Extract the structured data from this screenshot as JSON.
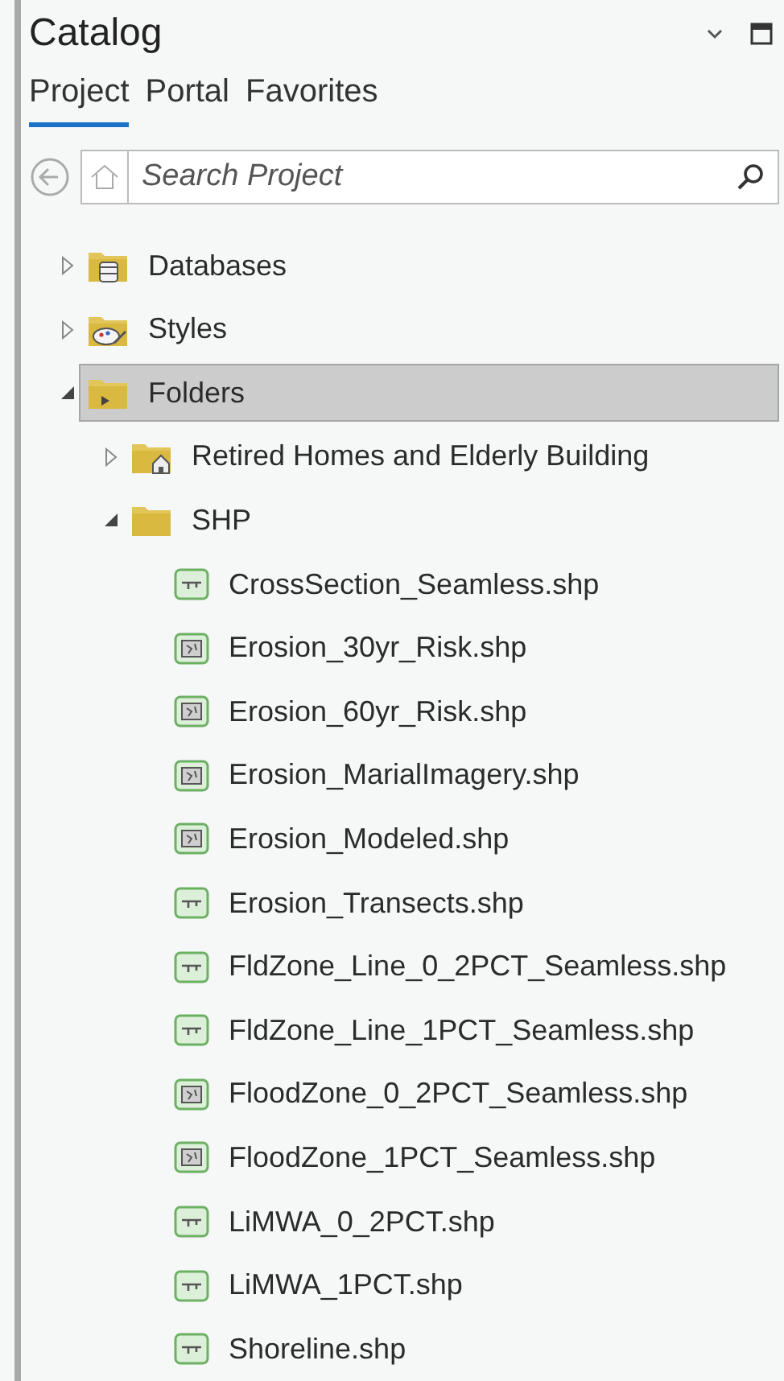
{
  "panel": {
    "title": "Catalog"
  },
  "tabs": [
    {
      "label": "Project",
      "selected": true
    },
    {
      "label": "Portal",
      "selected": false
    },
    {
      "label": "Favorites",
      "selected": false
    }
  ],
  "search": {
    "placeholder": "Search Project"
  },
  "tree": [
    {
      "label": "Databases",
      "kind": "database",
      "expanded": false,
      "selected": false
    },
    {
      "label": "Styles",
      "kind": "styles",
      "expanded": false,
      "selected": false
    },
    {
      "label": "Folders",
      "kind": "folders",
      "expanded": true,
      "selected": true,
      "children": [
        {
          "label": "Retired Homes and Elderly Building",
          "kind": "home-folder",
          "expanded": false,
          "selected": false
        },
        {
          "label": "SHP",
          "kind": "folder",
          "expanded": true,
          "selected": false,
          "children": [
            {
              "label": "CrossSection_Seamless.shp",
              "kind": "line",
              "selected": false
            },
            {
              "label": "Erosion_30yr_Risk.shp",
              "kind": "polygon",
              "selected": false
            },
            {
              "label": "Erosion_60yr_Risk.shp",
              "kind": "polygon",
              "selected": false
            },
            {
              "label": "Erosion_MarialImagery.shp",
              "kind": "polygon",
              "selected": false
            },
            {
              "label": "Erosion_Modeled.shp",
              "kind": "polygon",
              "selected": false
            },
            {
              "label": "Erosion_Transects.shp",
              "kind": "line",
              "selected": false
            },
            {
              "label": "FldZone_Line_0_2PCT_Seamless.shp",
              "kind": "line",
              "selected": false
            },
            {
              "label": "FldZone_Line_1PCT_Seamless.shp",
              "kind": "line",
              "selected": false
            },
            {
              "label": "FloodZone_0_2PCT_Seamless.shp",
              "kind": "polygon",
              "selected": false
            },
            {
              "label": "FloodZone_1PCT_Seamless.shp",
              "kind": "polygon",
              "selected": false
            },
            {
              "label": "LiMWA_0_2PCT.shp",
              "kind": "line",
              "selected": false
            },
            {
              "label": "LiMWA_1PCT.shp",
              "kind": "line",
              "selected": false
            },
            {
              "label": "Shoreline.shp",
              "kind": "line",
              "selected": false
            }
          ]
        }
      ]
    }
  ]
}
